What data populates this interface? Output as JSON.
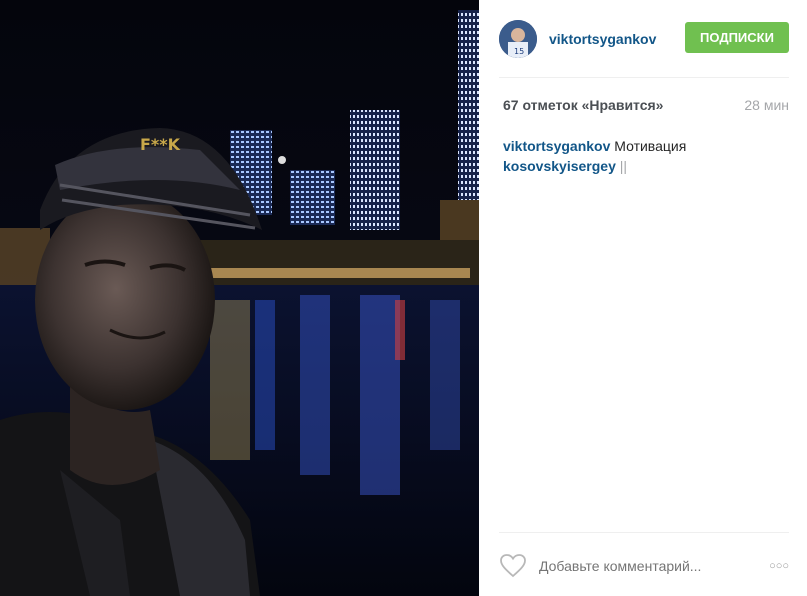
{
  "post": {
    "photo": {
      "icon": "selfie-night-city-photo"
    },
    "header": {
      "avatar_icon": "avatar-icon",
      "username": "viktortsygankov",
      "follow_label": "ПОДПИСКИ",
      "follow_color": "#70c050"
    },
    "stats": {
      "likes": "67 отметок «Нравится»",
      "time": "28 мин"
    },
    "caption": {
      "username": "viktortsygankov",
      "text": "Мотивация",
      "mention": "kosovskyisergey",
      "trailing": "||"
    },
    "comment": {
      "placeholder": "Добавьте комментарий...",
      "like_icon": "heart-icon",
      "more_icon": "more-options-icon"
    }
  }
}
